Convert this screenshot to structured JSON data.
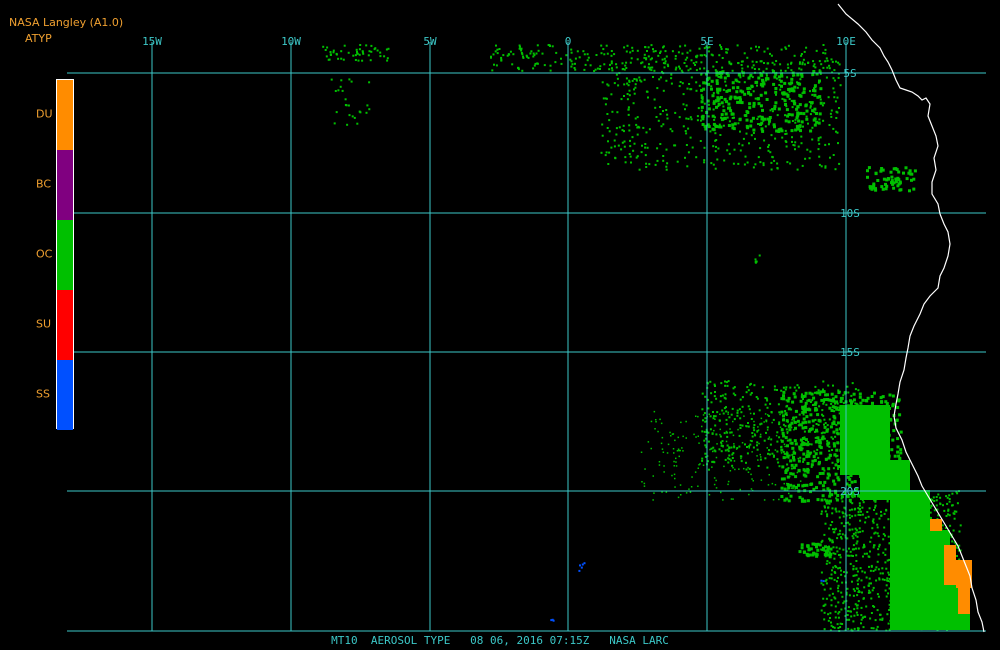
{
  "header": {
    "title": "NASA Langley (A1.0)",
    "product": "ATYP"
  },
  "legend": [
    {
      "label": "DU",
      "color": "#ff8c00"
    },
    {
      "label": "BC",
      "color": "#800080"
    },
    {
      "label": "OC",
      "color": "#00c000"
    },
    {
      "label": "SU",
      "color": "#ff0000"
    },
    {
      "label": "SS",
      "color": "#0050ff"
    }
  ],
  "map": {
    "projection": "cylindrical",
    "grid_color": "#3cc8c8",
    "coast_color": "#ffffff",
    "lon_labels": [
      "15W",
      "10W",
      "5W",
      "0",
      "5E",
      "10E"
    ],
    "lat_labels": [
      "5S",
      "10S",
      "15S",
      "20S"
    ],
    "aerosol_regions": [
      {
        "type": "OC",
        "area": "north band near 5S-8S, 5W to 10E"
      },
      {
        "type": "OC",
        "area": "small plume near 9S, 12E"
      },
      {
        "type": "OC",
        "area": "coastal plume 16S-24S, 5E to 14E"
      },
      {
        "type": "DU",
        "area": "coastal strip 20S-24S near 14E"
      },
      {
        "type": "SS",
        "area": "scattered pixels near 22S-24S, 0-1E"
      }
    ]
  },
  "footer": {
    "text": "MT10  AEROSOL TYPE   08 06, 2016 07:15Z   NASA LARC"
  }
}
